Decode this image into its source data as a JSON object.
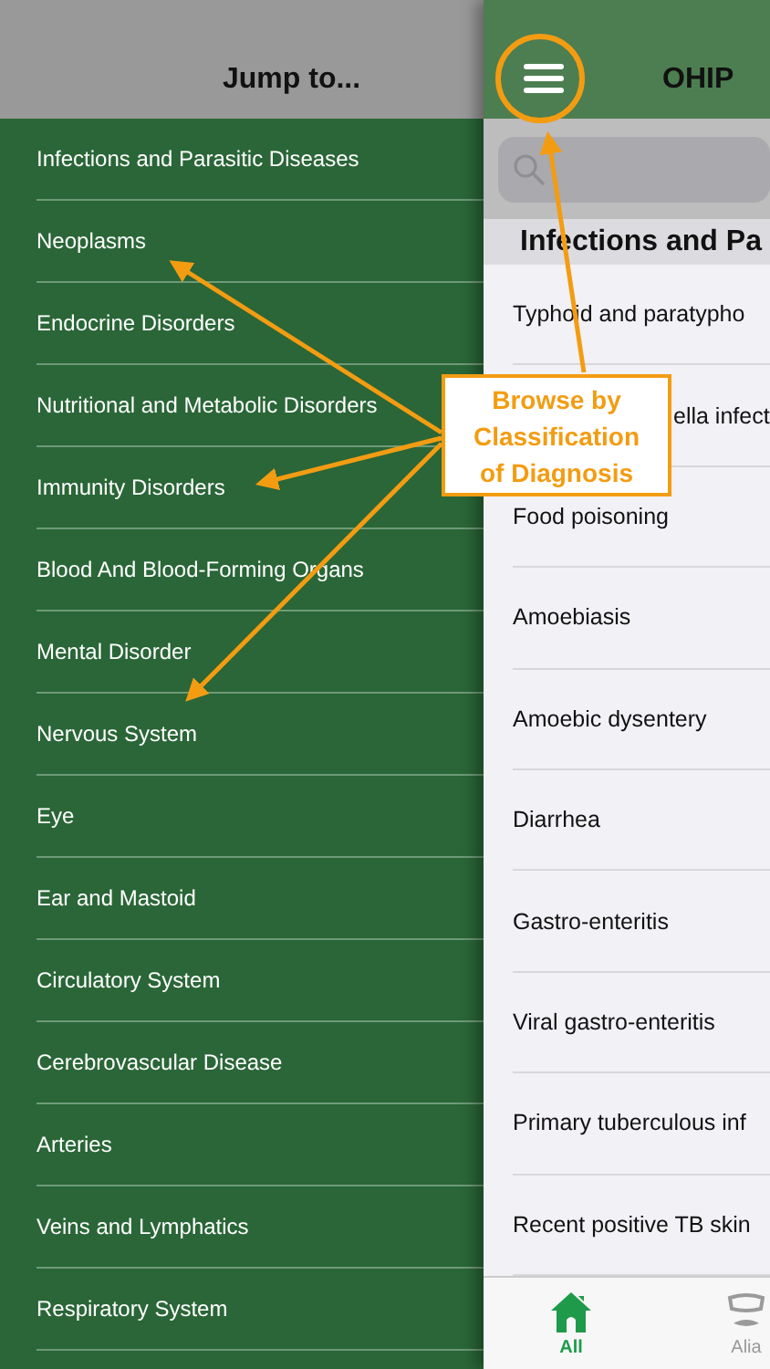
{
  "drawer": {
    "title": "Jump to...",
    "items": [
      {
        "label": "Infections and Parasitic Diseases"
      },
      {
        "label": "Neoplasms"
      },
      {
        "label": "Endocrine Disorders"
      },
      {
        "label": "Nutritional and Metabolic Disorders"
      },
      {
        "label": "Immunity Disorders"
      },
      {
        "label": "Blood And Blood-Forming Organs"
      },
      {
        "label": "Mental Disorder"
      },
      {
        "label": "Nervous System"
      },
      {
        "label": "Eye"
      },
      {
        "label": "Ear and Mastoid"
      },
      {
        "label": "Circulatory System"
      },
      {
        "label": "Cerebrovascular Disease"
      },
      {
        "label": "Arteries"
      },
      {
        "label": "Veins and Lymphatics"
      },
      {
        "label": "Respiratory System"
      }
    ]
  },
  "main": {
    "title": "OHIP",
    "section": "Infections and Pa",
    "rows": [
      {
        "label": "Typhoid and paratypho",
        "covered": false
      },
      {
        "label": "ella infect",
        "covered": true
      },
      {
        "label": "Food poisoning",
        "covered": false
      },
      {
        "label": "Amoebiasis",
        "covered": false
      },
      {
        "label": "Amoebic dysentery",
        "covered": false
      },
      {
        "label": "Diarrhea",
        "covered": false
      },
      {
        "label": "Gastro-enteritis",
        "covered": false
      },
      {
        "label": "Viral gastro-enteritis",
        "covered": false
      },
      {
        "label": "Primary tuberculous inf",
        "covered": false
      },
      {
        "label": "Recent positive TB skin",
        "covered": false
      }
    ],
    "tabs": [
      {
        "label": "All",
        "kind": "home",
        "selected": true
      },
      {
        "label": "Alia",
        "kind": "alias",
        "selected": false
      }
    ]
  },
  "callout": {
    "text": "Browse by Classification of Diagnosis"
  }
}
